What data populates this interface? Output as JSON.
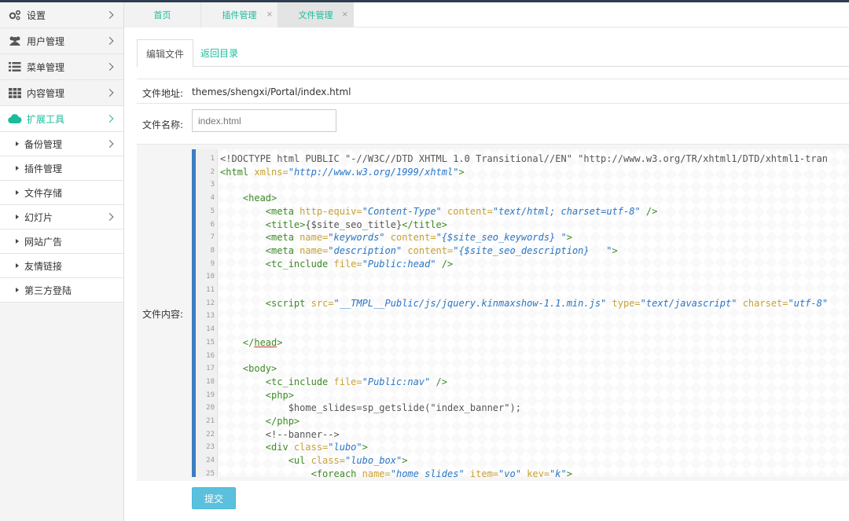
{
  "sidebar": {
    "items": [
      {
        "label": "设置",
        "icon": "gears-icon"
      },
      {
        "label": "用户管理",
        "icon": "users-icon"
      },
      {
        "label": "菜单管理",
        "icon": "list-icon"
      },
      {
        "label": "内容管理",
        "icon": "grid-icon"
      },
      {
        "label": "扩展工具",
        "icon": "cloud-icon",
        "active": true
      }
    ],
    "subitems": [
      {
        "label": "备份管理",
        "has_arrow": true
      },
      {
        "label": "插件管理",
        "has_arrow": false
      },
      {
        "label": "文件存储",
        "has_arrow": false
      },
      {
        "label": "幻灯片",
        "has_arrow": true
      },
      {
        "label": "网站广告",
        "has_arrow": false
      },
      {
        "label": "友情链接",
        "has_arrow": false
      },
      {
        "label": "第三方登陆",
        "has_arrow": false
      }
    ]
  },
  "tabs": [
    {
      "label": "首页",
      "closable": false
    },
    {
      "label": "插件管理",
      "closable": true
    },
    {
      "label": "文件管理",
      "closable": true,
      "active": true
    }
  ],
  "tab_close_glyph": "×",
  "content_tabs": {
    "edit": "编辑文件",
    "back": "返回目录"
  },
  "form": {
    "path_label": "文件地址:",
    "path_value": "themes/shengxi/Portal/index.html",
    "name_label": "文件名称:",
    "name_placeholder": "index.html",
    "content_label": "文件内容:",
    "submit_label": "提交"
  },
  "code_lines": [
    [
      [
        "t",
        "<!DOCTYPE html PUBLIC \"-//W3C//DTD XHTML 1.0 Transitional//EN\" \"http://www.w3.org/TR/xhtml1/DTD/xhtml1-tran"
      ]
    ],
    [
      [
        "g",
        "<html "
      ],
      [
        "a",
        "xmlns="
      ],
      [
        "s",
        "\"http://www.w3.org/1999/xhtml\""
      ],
      [
        "g",
        ">"
      ]
    ],
    [],
    [
      [
        "t",
        "    "
      ],
      [
        "g",
        "<head>"
      ]
    ],
    [
      [
        "t",
        "        "
      ],
      [
        "g",
        "<meta "
      ],
      [
        "a",
        "http-equiv="
      ],
      [
        "s",
        "\"Content-Type\""
      ],
      [
        "a",
        " content="
      ],
      [
        "s",
        "\"text/html; charset=utf-8\""
      ],
      [
        "g",
        " />"
      ]
    ],
    [
      [
        "t",
        "        "
      ],
      [
        "g",
        "<title>"
      ],
      [
        "x",
        "{$site_seo_title}"
      ],
      [
        "g",
        "</title>"
      ]
    ],
    [
      [
        "t",
        "        "
      ],
      [
        "g",
        "<meta "
      ],
      [
        "a",
        "name="
      ],
      [
        "s",
        "\"keywords\""
      ],
      [
        "a",
        " content="
      ],
      [
        "s",
        "\"{$site_seo_keywords} \""
      ],
      [
        "g",
        ">"
      ]
    ],
    [
      [
        "t",
        "        "
      ],
      [
        "g",
        "<meta "
      ],
      [
        "a",
        "name="
      ],
      [
        "s",
        "\"description\""
      ],
      [
        "a",
        " content="
      ],
      [
        "s",
        "\"{$site_seo_description}   \""
      ],
      [
        "g",
        ">"
      ]
    ],
    [
      [
        "t",
        "        "
      ],
      [
        "g",
        "<tc_include "
      ],
      [
        "a",
        "file="
      ],
      [
        "s",
        "\"Public:head\""
      ],
      [
        "g",
        " />"
      ]
    ],
    [],
    [],
    [
      [
        "t",
        "        "
      ],
      [
        "g",
        "<script "
      ],
      [
        "a",
        "src="
      ],
      [
        "s",
        "\"__TMPL__Public/js/jquery.kinmaxshow-1.1.min.js\""
      ],
      [
        "a",
        " type="
      ],
      [
        "s",
        "\"text/javascript\""
      ],
      [
        "a",
        " charset="
      ],
      [
        "s",
        "\"utf-8\""
      ]
    ],
    [],
    [],
    [
      [
        "t",
        "    "
      ],
      [
        "g",
        "</"
      ],
      [
        "e",
        "head"
      ],
      [
        "g",
        ">"
      ]
    ],
    [],
    [
      [
        "t",
        "    "
      ],
      [
        "g",
        "<body>"
      ]
    ],
    [
      [
        "t",
        "        "
      ],
      [
        "g",
        "<tc_include "
      ],
      [
        "a",
        "file="
      ],
      [
        "s",
        "\"Public:nav\""
      ],
      [
        "g",
        " />"
      ]
    ],
    [
      [
        "t",
        "        "
      ],
      [
        "g",
        "<php>"
      ]
    ],
    [
      [
        "t",
        "            "
      ],
      [
        "x",
        "$home_slides=sp_getslide(\"index_banner\");"
      ]
    ],
    [
      [
        "t",
        "        "
      ],
      [
        "g",
        "</php>"
      ]
    ],
    [
      [
        "t",
        "        "
      ],
      [
        "x",
        "<!--banner-->"
      ]
    ],
    [
      [
        "t",
        "        "
      ],
      [
        "g",
        "<div "
      ],
      [
        "a",
        "class="
      ],
      [
        "s",
        "\"lubo\""
      ],
      [
        "g",
        ">"
      ]
    ],
    [
      [
        "t",
        "            "
      ],
      [
        "g",
        "<ul "
      ],
      [
        "a",
        "class="
      ],
      [
        "s",
        "\"lubo_box\""
      ],
      [
        "g",
        ">"
      ]
    ],
    [
      [
        "t",
        "                "
      ],
      [
        "g",
        "<foreach "
      ],
      [
        "a",
        "name="
      ],
      [
        "s",
        "\"home_slides\""
      ],
      [
        "a",
        " item="
      ],
      [
        "s",
        "\"vo\""
      ],
      [
        "a",
        " key="
      ],
      [
        "s",
        "\"k\""
      ],
      [
        "g",
        ">"
      ]
    ]
  ],
  "colors": {
    "accent": "#1abc9c",
    "submit": "#5bc0de",
    "editor_border": "#3c7dbf"
  }
}
